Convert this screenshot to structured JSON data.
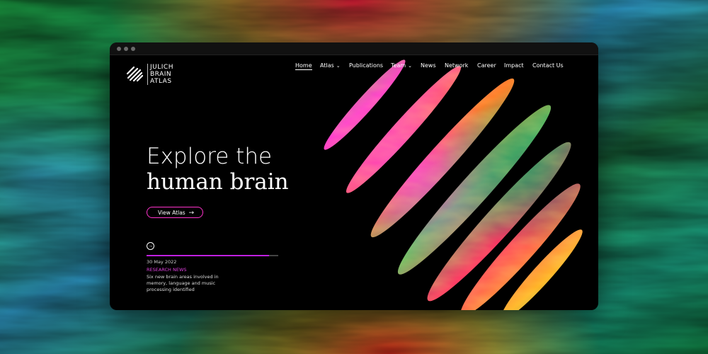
{
  "logo": {
    "lines": [
      "JULICH",
      "BRAIN",
      "ATLAS"
    ]
  },
  "nav": [
    {
      "label": "Home",
      "active": true,
      "dropdown": false
    },
    {
      "label": "Atlas",
      "active": false,
      "dropdown": true
    },
    {
      "label": "Publications",
      "active": false,
      "dropdown": false
    },
    {
      "label": "Team",
      "active": false,
      "dropdown": true
    },
    {
      "label": "News",
      "active": false,
      "dropdown": false
    },
    {
      "label": "Network",
      "active": false,
      "dropdown": false
    },
    {
      "label": "Career",
      "active": false,
      "dropdown": false
    },
    {
      "label": "Impact",
      "active": false,
      "dropdown": false
    },
    {
      "label": "Contact Us",
      "active": false,
      "dropdown": false
    }
  ],
  "hero": {
    "title_line1": "Explore the",
    "title_line2": "human brain",
    "cta_label": "View Atlas",
    "cta_icon": "arrow-right-icon"
  },
  "news": {
    "date": "30 May 2022",
    "category": "RESEARCH NEWS",
    "headline": "Six new brain areas involved in memory, language and music processing identified",
    "slider_progress": 0.93
  },
  "colors": {
    "accent": "#ff33cc",
    "window_bg": "#000000",
    "text": "#ffffff"
  }
}
